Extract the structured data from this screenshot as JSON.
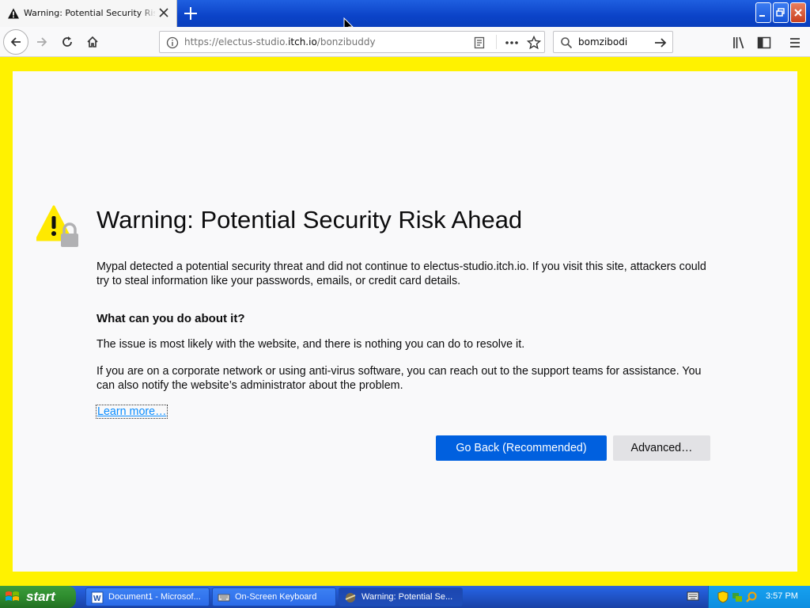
{
  "browser": {
    "tab_title": "Warning: Potential Security Risk Ahead",
    "url_prefix": "https://electus-studio.",
    "url_host": "itch.io",
    "url_path": "/bonzibuddy",
    "search_value": "bomzibodi"
  },
  "page": {
    "heading": "Warning: Potential Security Risk Ahead",
    "intro": "Mypal detected a potential security threat and did not continue to electus-studio.itch.io. If you visit this site, attackers could try to steal information like your passwords, emails, or credit card details.",
    "subheading": "What can you do about it?",
    "para1": "The issue is most likely with the website, and there is nothing you can do to resolve it.",
    "para2": "If you are on a corporate network or using anti-virus software, you can reach out to the support teams for assistance. You can also notify the website’s administrator about the problem.",
    "learn_more": "Learn more…",
    "go_back_label": "Go Back (Recommended)",
    "advanced_label": "Advanced…"
  },
  "taskbar": {
    "start_label": "start",
    "tasks": [
      {
        "label": "Document1 - Microsof...",
        "icon": "word-icon"
      },
      {
        "label": "On-Screen Keyboard",
        "icon": "keyboard-icon"
      },
      {
        "label": "Warning: Potential Se...",
        "icon": "browser-icon"
      }
    ],
    "clock": "3:57 PM"
  },
  "colors": {
    "frame": "#fff200",
    "primary_button": "#0060df",
    "link": "#0a8dff"
  }
}
